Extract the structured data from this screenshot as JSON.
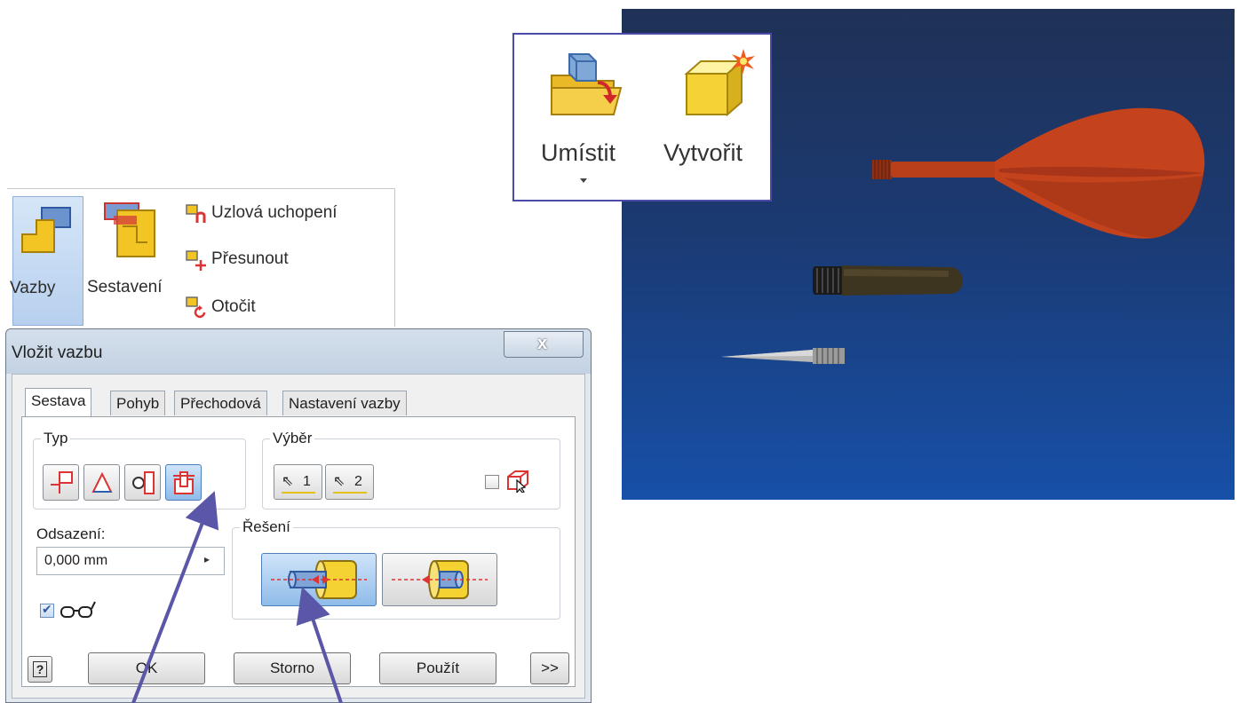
{
  "place_panel": {
    "place_label": "Umístit",
    "create_label": "Vytvořit"
  },
  "relationships_panel": {
    "constrain_label": "Vazby",
    "assemble_label": "Sestavení",
    "items": [
      {
        "icon": "grip-snap-icon",
        "label": "Uzlová uchopení"
      },
      {
        "icon": "move-icon",
        "label": "Přesunout"
      },
      {
        "icon": "rotate-icon",
        "label": "Otočit"
      }
    ]
  },
  "dialog": {
    "title": "Vložit vazbu",
    "close_glyph": "x",
    "tabs": [
      "Sestava",
      "Pohyb",
      "Přechodová",
      "Nastavení vazby"
    ],
    "active_tab": "Sestava",
    "type_group_label": "Typ",
    "selection_group_label": "Výběr",
    "selection_buttons": [
      "1",
      "2"
    ],
    "offset_label": "Odsazení:",
    "offset_value": "0,000 mm",
    "solution_group_label": "Řešení",
    "buttons": {
      "ok": "OK",
      "cancel": "Storno",
      "apply": "Použít",
      "expand": ">>",
      "help": "?"
    }
  },
  "colors": {
    "viewport_top": "#1f3156",
    "viewport_bottom": "#1750a8",
    "flight_orange": "#c4431d",
    "barrel_dark": "#3e3520",
    "tip_grey": "#b8b8b8",
    "annotation_arrow": "#5b57a8",
    "selected_blue": "#8fbce9"
  }
}
